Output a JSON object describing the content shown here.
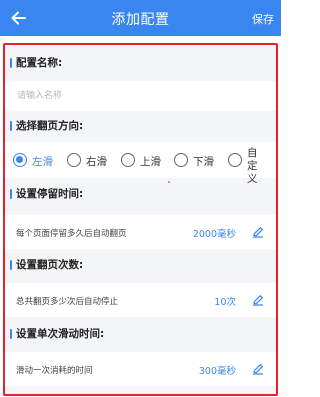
{
  "header": {
    "title": "添加配置",
    "save_label": "保存",
    "back_icon": "arrow-left-icon"
  },
  "name_section": {
    "label": "配置名称:",
    "placeholder": "请输入名称",
    "value": ""
  },
  "direction_section": {
    "label": "选择翻页方向:",
    "selected": "左滑",
    "options": [
      "左滑",
      "右滑",
      "上滑",
      "下滑",
      "自定义"
    ]
  },
  "dwell_section": {
    "label": "设置停留时间:",
    "description": "每个页面停留多久后自动翻页",
    "value": "2000毫秒"
  },
  "count_section": {
    "label": "设置翻页次数:",
    "description": "总共翻页多少次后自动停止",
    "value": "10次"
  },
  "swipe_section": {
    "label": "设置单次滑动时间:",
    "description": "滑动一次消耗的时间",
    "value": "300毫秒"
  },
  "colors": {
    "accent": "#3a86f0",
    "highlight_frame": "#e8202a",
    "section_bg": "#f4f5f7"
  }
}
